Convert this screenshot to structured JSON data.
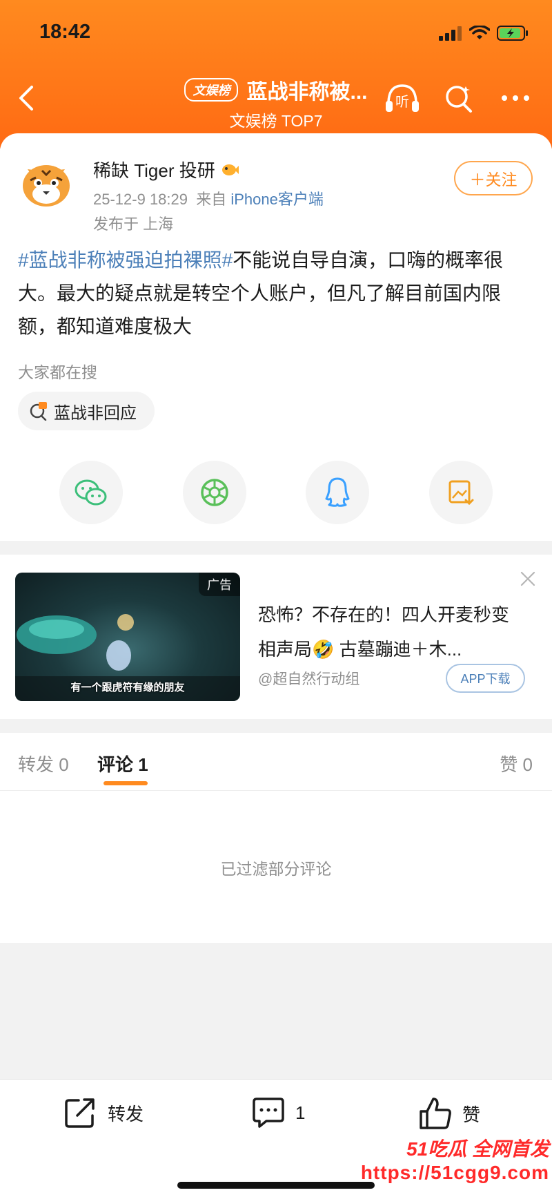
{
  "status": {
    "time": "18:42"
  },
  "header": {
    "rank_tag": "文娱榜",
    "title": "蓝战非称被...",
    "subtitle": "文娱榜 TOP7",
    "listen_label": "听"
  },
  "post": {
    "username": "稀缺 Tiger 投研",
    "date": "25-12-9 18:29",
    "from_prefix": "来自",
    "source": "iPhone客户端",
    "location": "发布于 上海",
    "follow_label": "＋关注",
    "hashtag": "#蓝战非称被强迫拍裸照#",
    "body": "不能说自导自演，口嗨的概率很大。最大的疑点就是转空个人账户，但凡了解目前国内限额，都知道难度极大",
    "search_header": "大家都在搜",
    "search_chip": "蓝战非回应"
  },
  "share": [
    {
      "icon": "wechat-icon"
    },
    {
      "icon": "moments-icon"
    },
    {
      "icon": "qq-icon"
    },
    {
      "icon": "save-image-icon"
    }
  ],
  "ad": {
    "badge": "广告",
    "caption": "有一个跟虎符有缘的朋友",
    "title": "恐怖？不存在的！四人开麦秒变相声局🤣 古墓蹦迪＋木...",
    "source": "@超自然行动组",
    "download_label": "APP下载"
  },
  "tabs": {
    "repost_label": "转发",
    "repost_count": "0",
    "comment_label": "评论",
    "comment_count": "1",
    "like_label": "赞",
    "like_count": "0"
  },
  "comments": {
    "filtered_note": "已过滤部分评论"
  },
  "bottom_bar": {
    "repost_label": "转发",
    "comment_count": "1",
    "like_label": "赞"
  },
  "watermark": {
    "line1": "51吃瓜 全网首发",
    "line2": "https://51cgg9.com"
  },
  "colors": {
    "header_orange": "#ff7a18",
    "link_blue": "#4b7fb8",
    "follow_orange": "#ff8a1f",
    "watermark_red": "#ff2a2a"
  }
}
